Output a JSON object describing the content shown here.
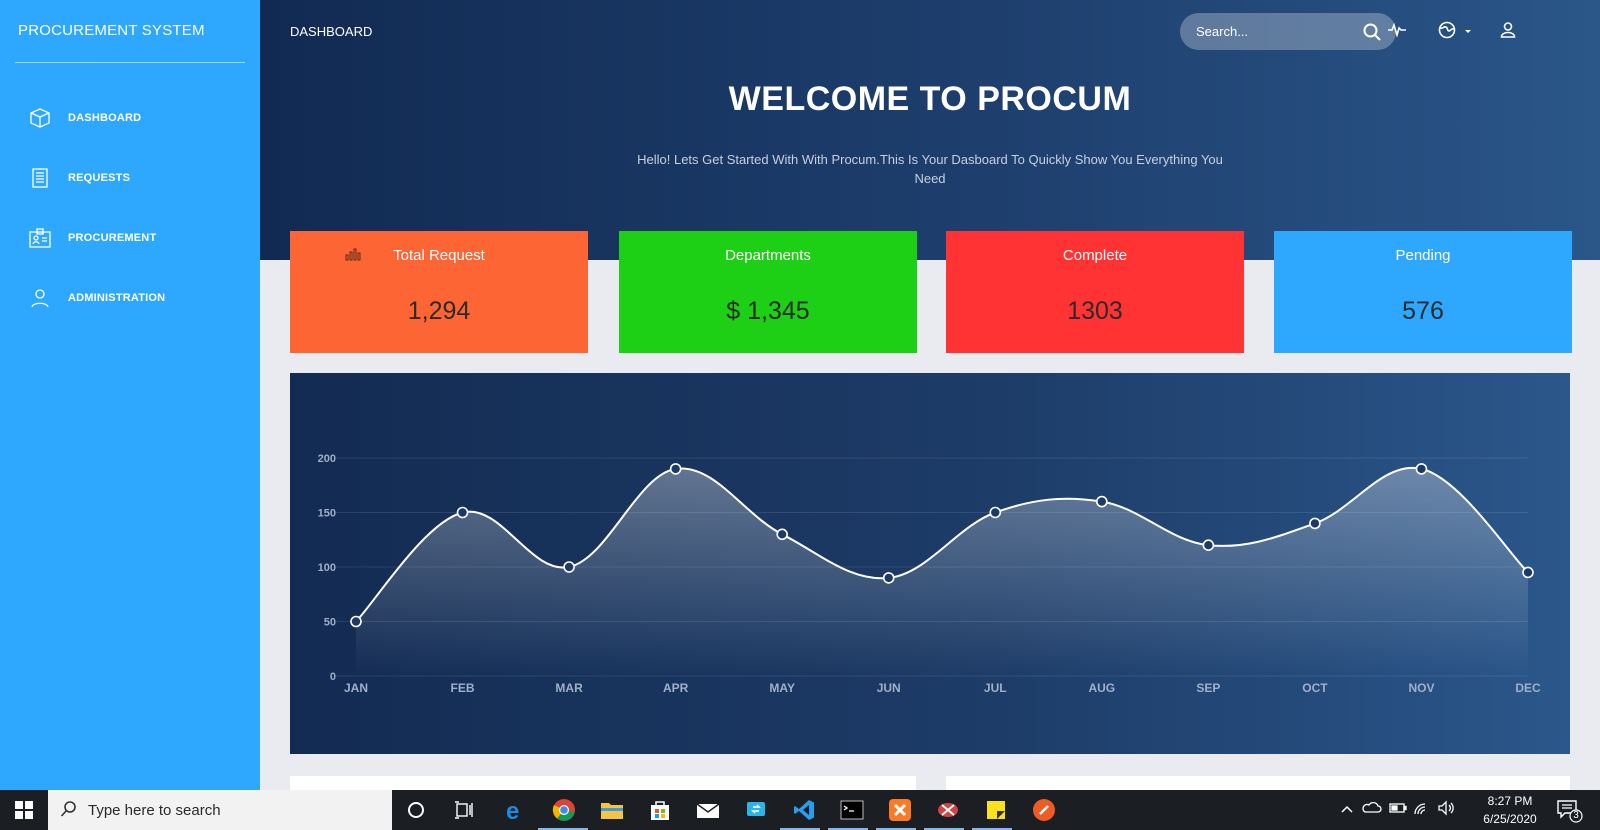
{
  "sidebar": {
    "brand": "PROCUREMENT SYSTEM",
    "items": [
      {
        "label": "DASHBOARD",
        "icon": "box-icon"
      },
      {
        "label": "REQUESTS",
        "icon": "document-list-icon"
      },
      {
        "label": "PROCUREMENT",
        "icon": "clipboard-id-icon"
      },
      {
        "label": "ADMINISTRATION",
        "icon": "user-icon"
      }
    ]
  },
  "header": {
    "breadcrumb": "DASHBOARD",
    "search_placeholder": "Search..."
  },
  "hero": {
    "title": "WELCOME TO PROCUM",
    "subtitle": "Hello! Lets Get Started With With Procum.This Is Your Dasboard To Quickly Show You Everything You Need"
  },
  "stats": [
    {
      "title": "Total Request",
      "value": "1,294",
      "color": "#fd6535"
    },
    {
      "title": "Departments",
      "value": "$ 1,345",
      "color": "#1dcf15"
    },
    {
      "title": "Complete",
      "value": "1303",
      "color": "#ff3333"
    },
    {
      "title": "Pending",
      "value": "576",
      "color": "#2ea7ff"
    }
  ],
  "chart_data": {
    "type": "area",
    "categories": [
      "JAN",
      "FEB",
      "MAR",
      "APR",
      "MAY",
      "JUN",
      "JUL",
      "AUG",
      "SEP",
      "OCT",
      "NOV",
      "DEC"
    ],
    "series": [
      {
        "values": [
          50,
          150,
          100,
          190,
          130,
          90,
          150,
          160,
          120,
          140,
          190,
          95
        ]
      }
    ],
    "yticks": [
      0,
      50,
      100,
      150,
      200
    ],
    "ylim": [
      0,
      200
    ],
    "grid": true,
    "line_color": "#ffffff"
  },
  "taskbar": {
    "search_placeholder": "Type here to search",
    "time": "8:27 PM",
    "date": "6/25/2020",
    "notification_count": "3"
  }
}
